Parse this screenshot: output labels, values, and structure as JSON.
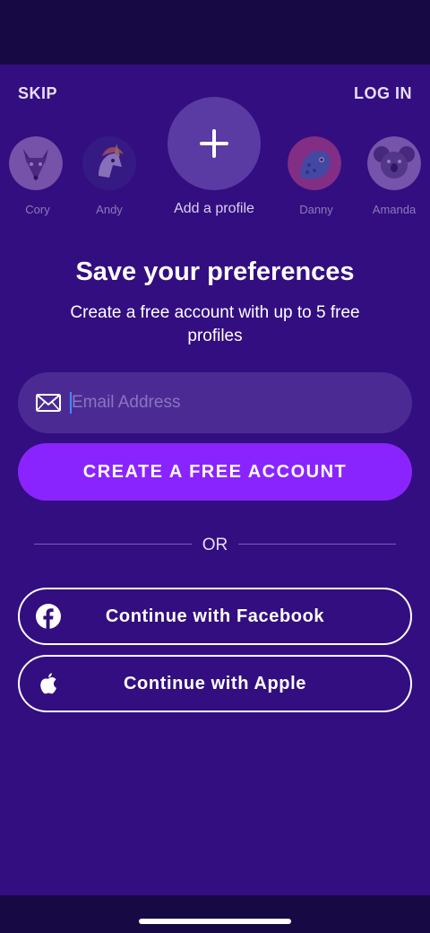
{
  "top_nav": {
    "skip": "SKIP",
    "login": "LOG IN"
  },
  "profiles": [
    {
      "name": "Cory",
      "icon": "fox-avatar-icon"
    },
    {
      "name": "Andy",
      "icon": "unicorn-avatar-icon"
    },
    {
      "name": "Danny",
      "icon": "dinosaur-avatar-icon"
    },
    {
      "name": "Amanda",
      "icon": "koala-avatar-icon"
    }
  ],
  "add_profile": {
    "label": "Add a profile",
    "icon": "plus-icon"
  },
  "heading": {
    "title": "Save your preferences",
    "subtitle": "Create a free account with up to 5 free profiles"
  },
  "email": {
    "placeholder": "Email Address",
    "value": "",
    "icon": "mail-icon"
  },
  "buttons": {
    "create_account": "CREATE A FREE ACCOUNT",
    "or": "OR",
    "facebook": "Continue with Facebook",
    "apple": "Continue with Apple"
  },
  "colors": {
    "background": "#330e80",
    "primary_button": "#8a24ff",
    "input_background": "#4b2b93"
  }
}
